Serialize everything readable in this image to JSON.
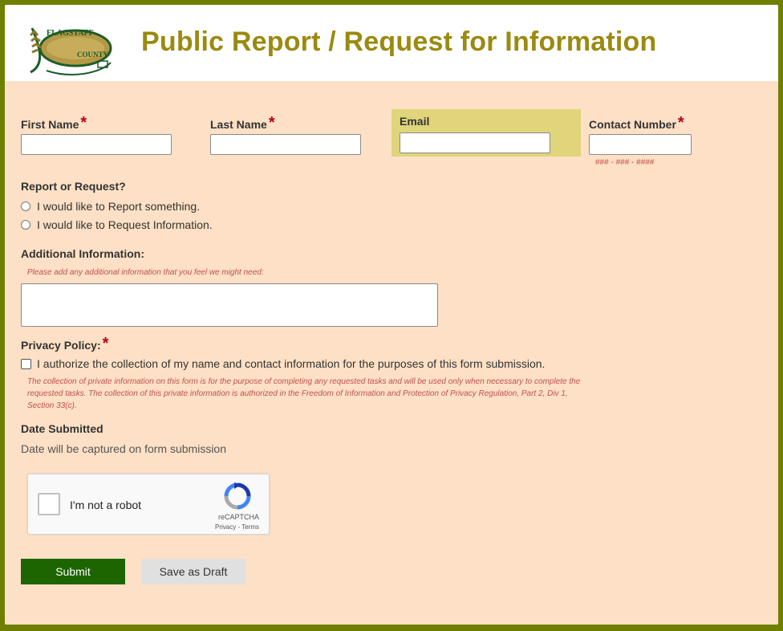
{
  "header": {
    "title": "Public Report / Request for Information",
    "logo_text_top": "FLAGSTAFF",
    "logo_text_bottom": "COUNTY"
  },
  "form": {
    "first_name": {
      "label": "First Name",
      "required_mark": "*",
      "value": ""
    },
    "last_name": {
      "label": "Last Name",
      "required_mark": "*",
      "value": ""
    },
    "email": {
      "label": "Email",
      "value": ""
    },
    "contact_number": {
      "label": "Contact Number",
      "required_mark": "*",
      "value": "",
      "hint": "### - ### - ####"
    },
    "report_or_request": {
      "label": "Report or Request?",
      "options": [
        "I would like to Report something.",
        "I would like to Request Information."
      ],
      "selected": null
    },
    "additional_info": {
      "label": "Additional Information:",
      "hint": "Please add any additional information that you feel we might need:",
      "value": ""
    },
    "privacy": {
      "label": "Privacy Policy:",
      "required_mark": "*",
      "checkbox_label": "I authorize the collection of my name and contact information for the purposes of this form submission.",
      "checked": false,
      "note": "The collection of private information on this form is for the purpose of completing any requested tasks and will be used only when necessary to complete the requested tasks. The collection of this private information is authorized in the Freedom of Information and Protection of Privacy Regulation, Part 2, Div 1, Section 33(c)."
    },
    "date_submitted": {
      "label": "Date Submitted",
      "text": "Date will be captured on form submission"
    },
    "captcha": {
      "label": "I'm not a robot",
      "brand": "reCAPTCHA",
      "privacy": "Privacy",
      "separator": "-",
      "terms": "Terms"
    },
    "buttons": {
      "submit": "Submit",
      "save_draft": "Save as Draft"
    }
  },
  "colors": {
    "frame": "#6f8001",
    "background": "#fde0c5",
    "title": "#9a8a10",
    "email_highlight": "#e0d57b",
    "submit": "#1c6500",
    "required": "#b3001b",
    "hint": "#c0504d"
  }
}
